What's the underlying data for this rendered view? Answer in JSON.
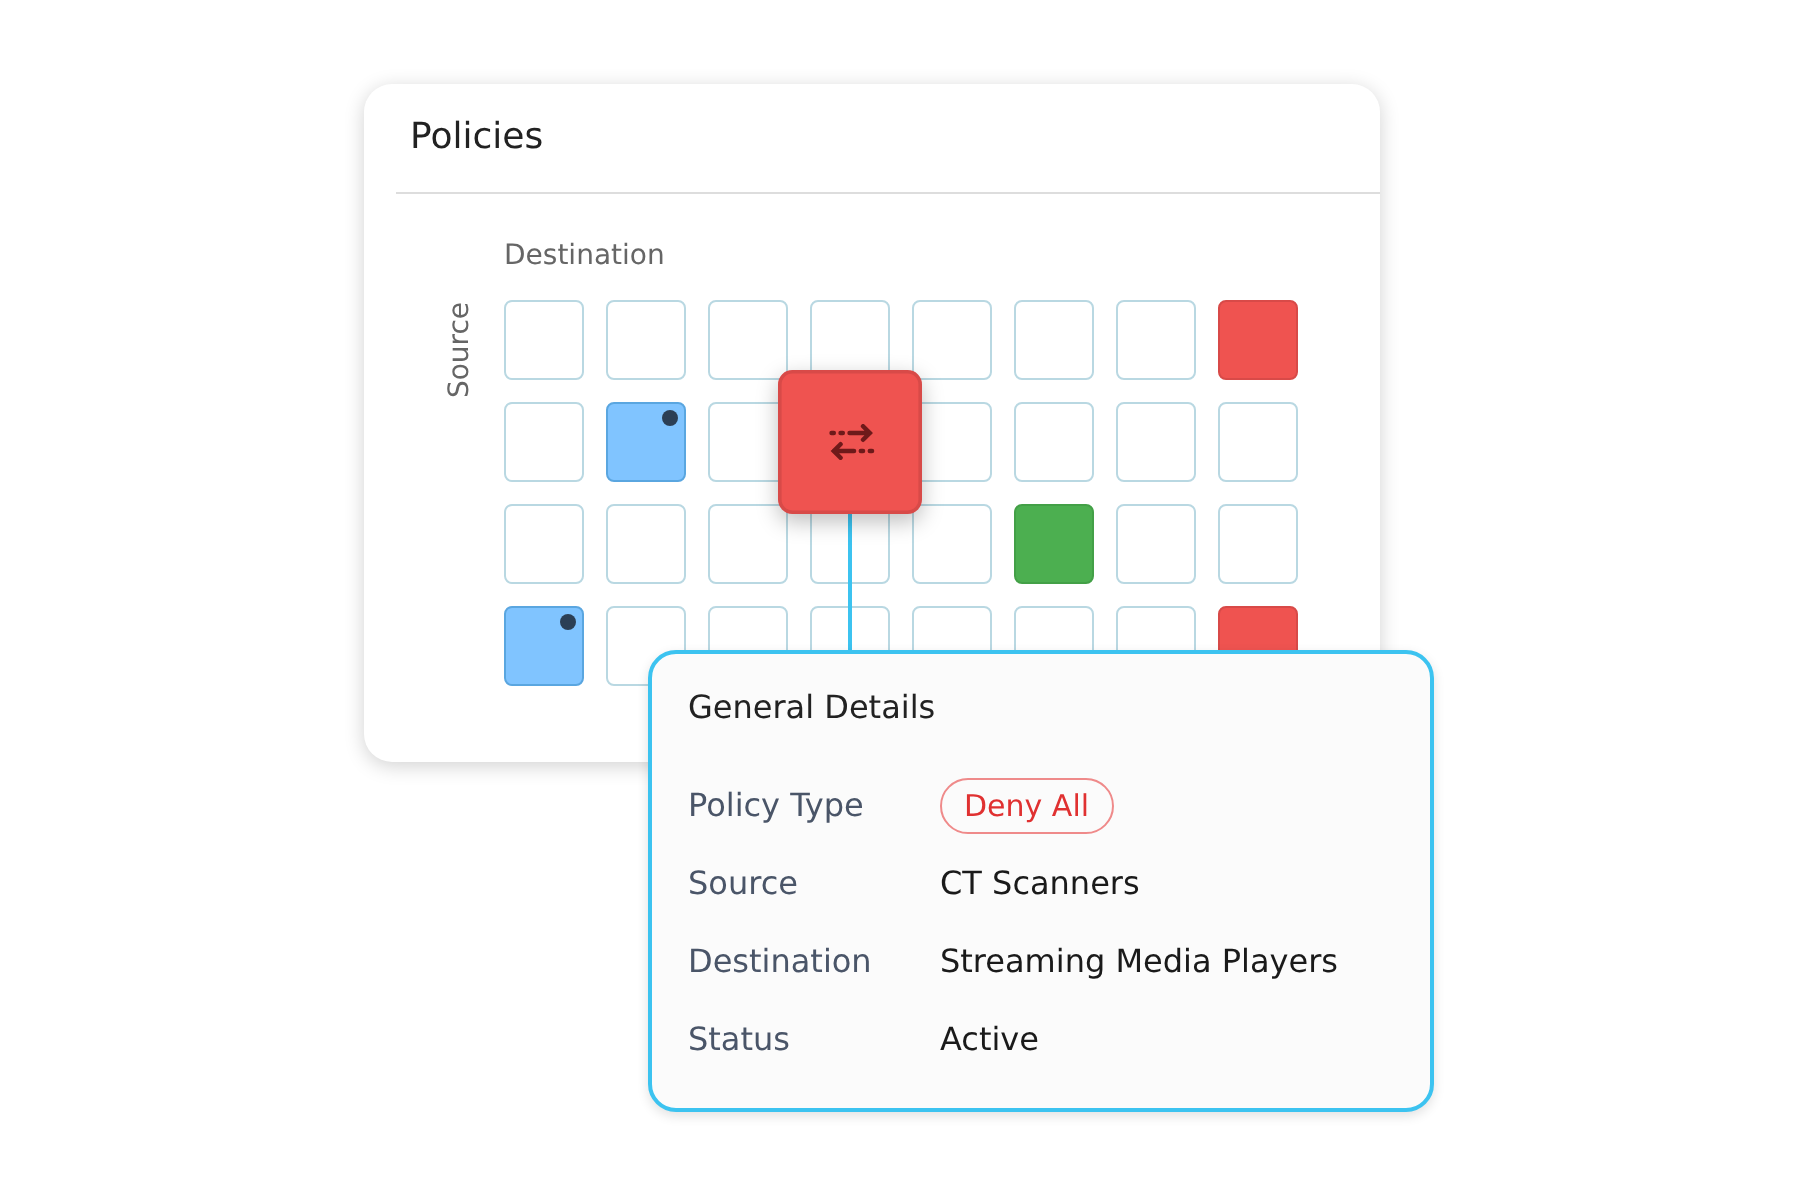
{
  "card": {
    "title": "Policies"
  },
  "grid": {
    "x_label": "Destination",
    "y_label": "Source",
    "rows": [
      {
        "cells": [
          {
            "kind": "empty",
            "selected": false
          },
          {
            "kind": "empty",
            "selected": false
          },
          {
            "kind": "empty",
            "selected": false
          },
          {
            "kind": "empty",
            "selected": false
          },
          {
            "kind": "empty",
            "selected": false
          },
          {
            "kind": "empty",
            "selected": false
          },
          {
            "kind": "empty",
            "selected": false
          },
          {
            "kind": "deny",
            "selected": false
          }
        ]
      },
      {
        "cells": [
          {
            "kind": "empty",
            "selected": false
          },
          {
            "kind": "custom",
            "selected": false
          },
          {
            "kind": "empty",
            "selected": false
          },
          {
            "kind": "deny",
            "selected": true
          },
          {
            "kind": "empty",
            "selected": false
          },
          {
            "kind": "empty",
            "selected": false
          },
          {
            "kind": "empty",
            "selected": false
          },
          {
            "kind": "empty",
            "selected": false
          }
        ]
      },
      {
        "cells": [
          {
            "kind": "empty",
            "selected": false
          },
          {
            "kind": "empty",
            "selected": false
          },
          {
            "kind": "empty",
            "selected": false
          },
          {
            "kind": "empty",
            "selected": false
          },
          {
            "kind": "empty",
            "selected": false
          },
          {
            "kind": "allow",
            "selected": false
          },
          {
            "kind": "empty",
            "selected": false
          },
          {
            "kind": "empty",
            "selected": false
          }
        ]
      },
      {
        "cells": [
          {
            "kind": "custom",
            "selected": false
          },
          {
            "kind": "empty",
            "selected": false
          },
          {
            "kind": "empty",
            "selected": false
          },
          {
            "kind": "empty",
            "selected": false
          },
          {
            "kind": "empty",
            "selected": false
          },
          {
            "kind": "empty",
            "selected": false
          },
          {
            "kind": "empty",
            "selected": false
          },
          {
            "kind": "deny",
            "selected": false
          }
        ]
      }
    ]
  },
  "details": {
    "title": "General Details",
    "rows": [
      {
        "label": "Policy Type",
        "value": "Deny All",
        "kind": "badge"
      },
      {
        "label": "Source",
        "value": "CT Scanners",
        "kind": "text"
      },
      {
        "label": "Destination",
        "value": "Streaming Media Players",
        "kind": "text"
      },
      {
        "label": "Status",
        "value": "Active",
        "kind": "text"
      }
    ]
  }
}
